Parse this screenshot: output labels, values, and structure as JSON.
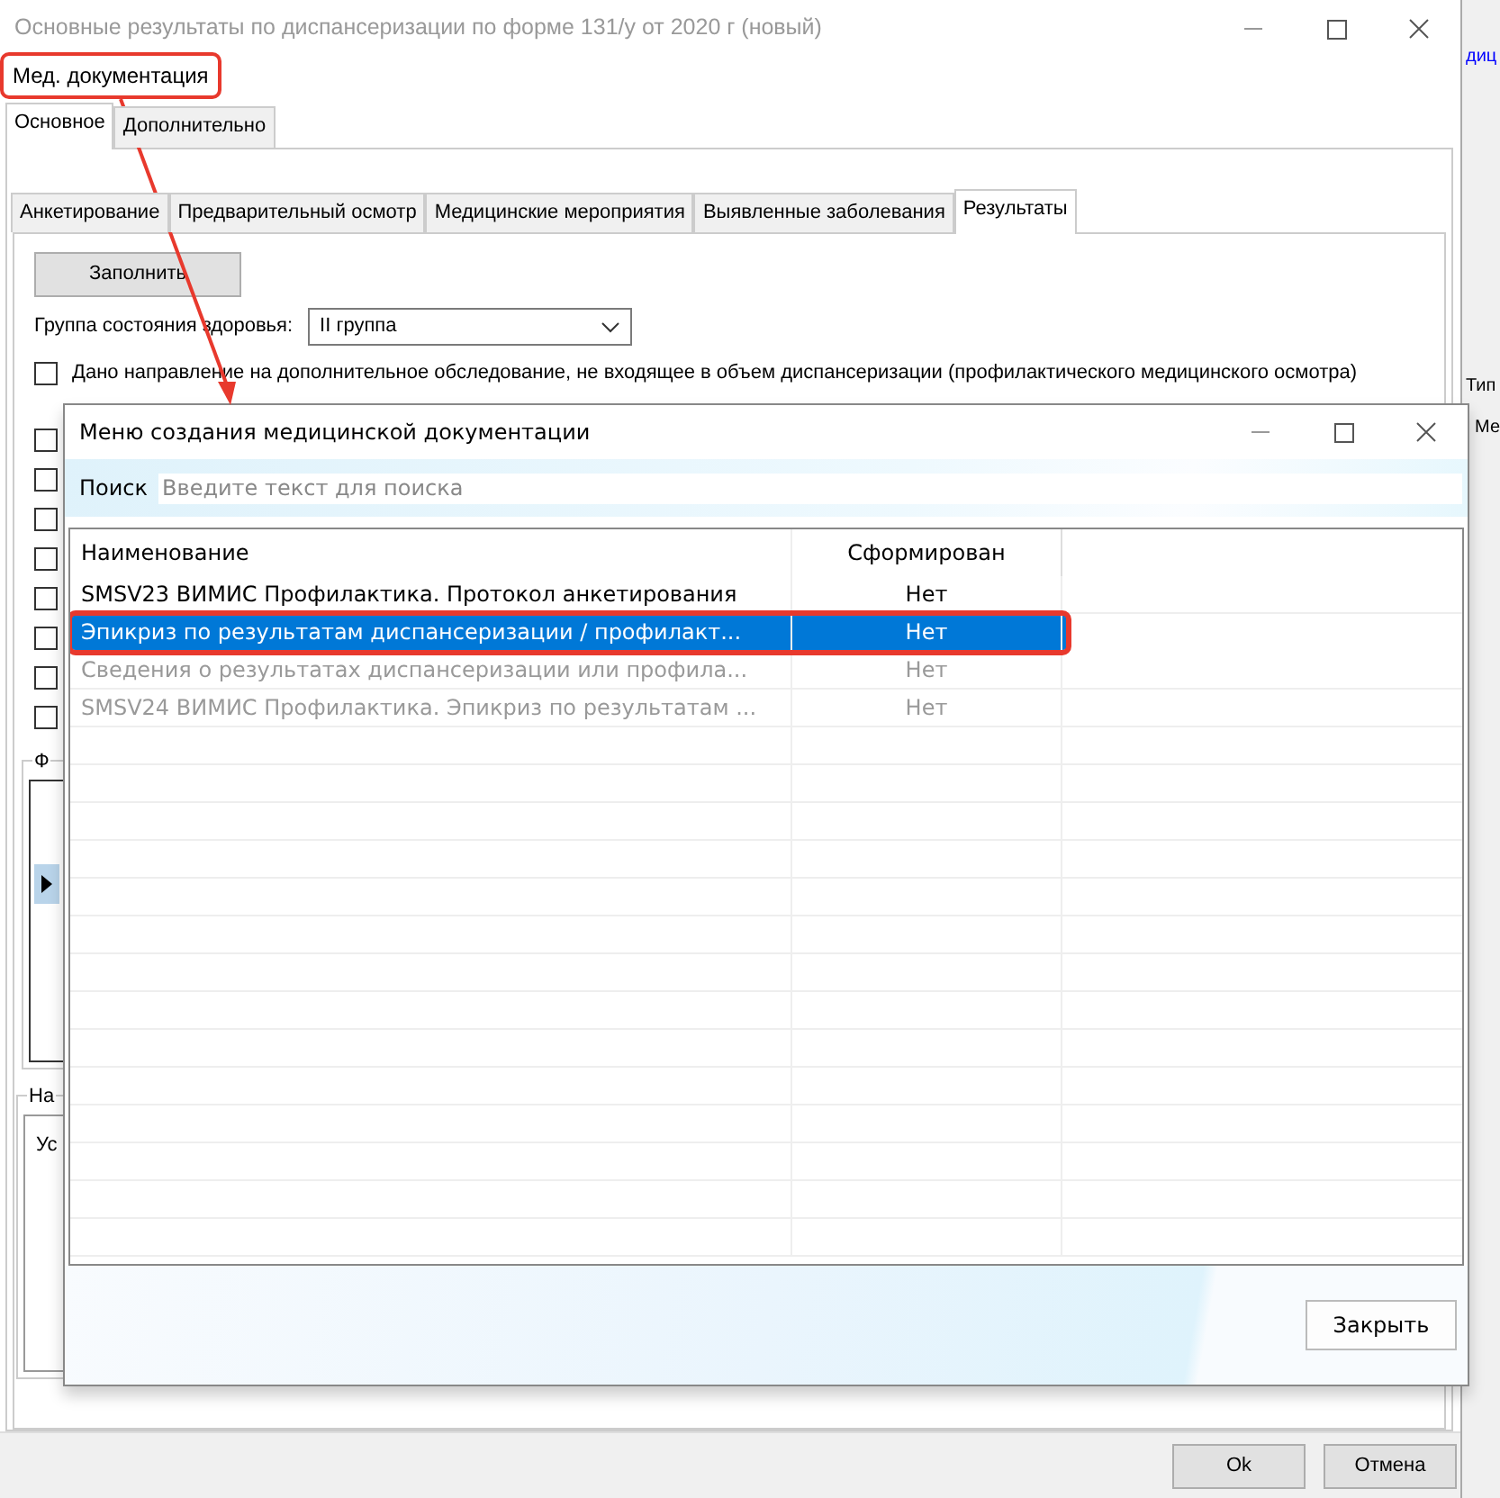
{
  "window": {
    "title": "Основные результаты по диспансеризации по форме 131/у от 2020 г (новый)",
    "menu": [
      {
        "label": "Мед. документация",
        "highlighted": true
      }
    ],
    "tabs": [
      {
        "label": "Основное",
        "selected": true
      },
      {
        "label": "Дополнительно",
        "selected": false
      }
    ],
    "inner_tabs": [
      {
        "label": "Анкетирование",
        "selected": false
      },
      {
        "label": "Предварительный осмотр",
        "selected": false
      },
      {
        "label": "Медицинские мероприятия",
        "selected": false
      },
      {
        "label": "Выявленные заболевания",
        "selected": false
      },
      {
        "label": "Результаты",
        "selected": true
      }
    ],
    "fill_button": "Заполнить",
    "health_group": {
      "label": "Группа состояния здоровья:",
      "value": "II группа"
    },
    "referral": {
      "label": "Дано направление на дополнительное обследование, не входящее в объем диспансеризации (профилактического медицинского осмотра)",
      "checked": false
    },
    "checkboxes": [
      {
        "checked": false
      },
      {
        "checked": false
      },
      {
        "checked": false
      },
      {
        "checked": false
      },
      {
        "checked": false
      },
      {
        "checked": false
      },
      {
        "checked": false
      },
      {
        "checked": false
      }
    ],
    "group_1": {
      "label": "Ф"
    },
    "group_2": {
      "label": "На",
      "column_1": "Ус"
    },
    "buttons": [
      "Ok",
      "Отмена"
    ]
  },
  "background_window": {
    "texts": [
      "диц",
      "Тип",
      "Ме"
    ]
  },
  "dialog": {
    "title": "Меню создания медицинской документации",
    "search": {
      "label": "Поиск",
      "placeholder": "Введите текст для поиска"
    },
    "table": {
      "columns": [
        "Наименование",
        "Сформирован"
      ],
      "rows": [
        {
          "name": "SMSV23 ВИМИС Профилактика. Протокол анкетирования",
          "status": "Нет",
          "selected": false,
          "disabled": false,
          "highlighted": false
        },
        {
          "name": "Эпикриз по результатам диспансеризации / профилакт...",
          "status": "Нет",
          "selected": true,
          "disabled": false,
          "highlighted": true
        },
        {
          "name": "Сведения о результатах диспансеризации или профила...",
          "status": "Нет",
          "selected": false,
          "disabled": true,
          "highlighted": false
        },
        {
          "name": "SMSV24 ВИМИС Профилактика. Эпикриз по результатам ...",
          "status": "Нет",
          "selected": false,
          "disabled": true,
          "highlighted": false
        }
      ]
    },
    "close_button": "Закрыть"
  }
}
